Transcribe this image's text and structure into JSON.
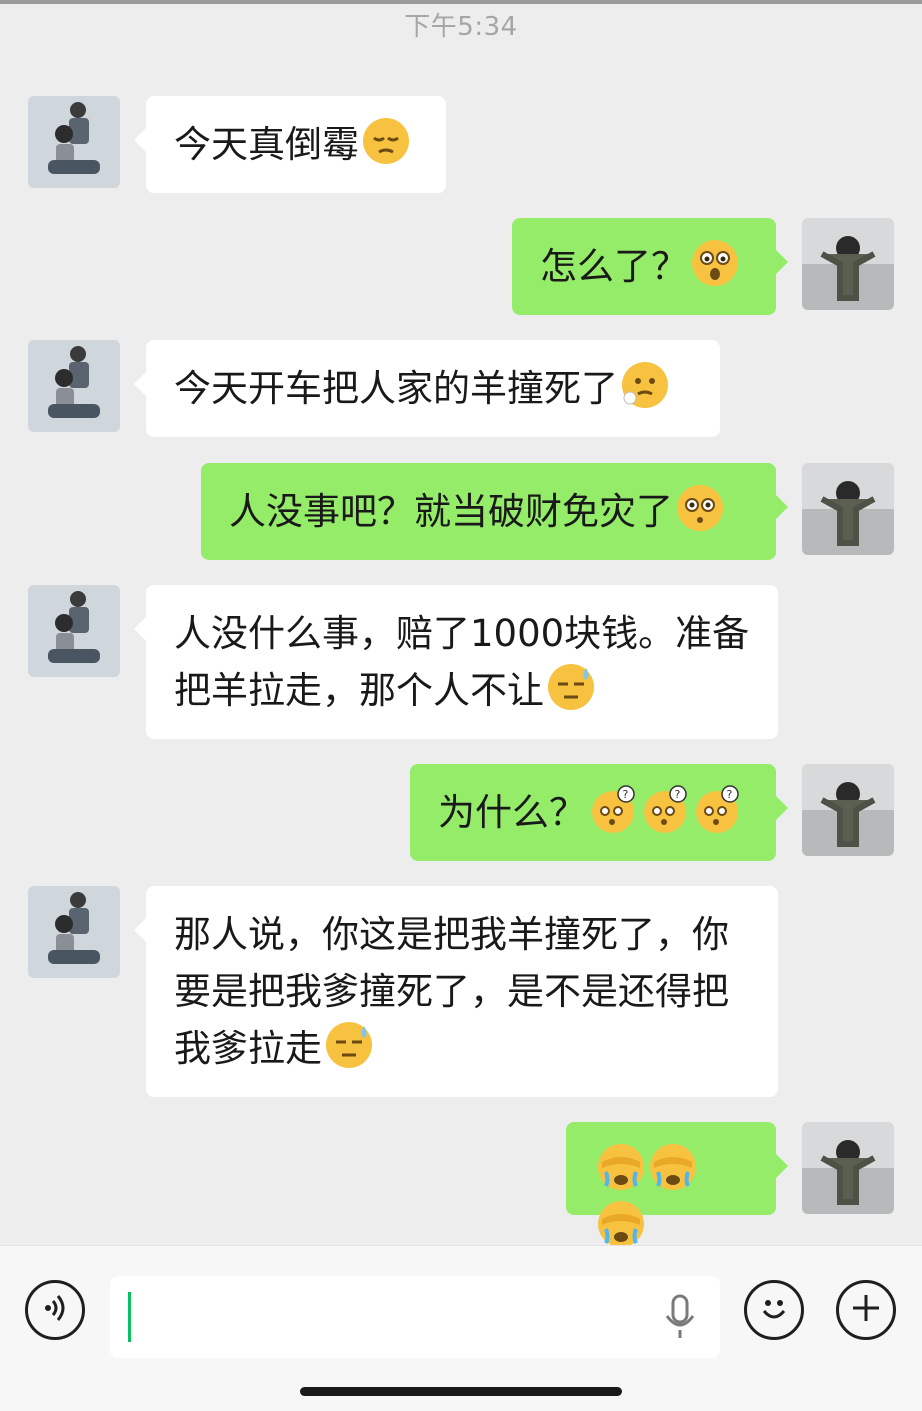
{
  "status": {
    "time": "下午5:34"
  },
  "messages": [
    {
      "side": "left",
      "text": "今天真倒霉",
      "emojis": [
        "pensive-emoji"
      ]
    },
    {
      "side": "right",
      "text": "怎么了？",
      "emojis": [
        "shocked-emoji"
      ]
    },
    {
      "side": "left",
      "text": "今天开车把人家的羊撞死了",
      "emojis": [
        "sigh-emoji"
      ]
    },
    {
      "side": "right",
      "text": "人没事吧？就当破财免灾了",
      "emojis": [
        "wide-eyed-emoji"
      ]
    },
    {
      "side": "left",
      "text": "人没什么事，赔了1000块钱。准备把羊拉走，那个人不让",
      "emojis": [
        "sweat-emoji"
      ]
    },
    {
      "side": "right",
      "text": "为什么？",
      "emojis": [
        "confused-emoji",
        "confused-emoji",
        "confused-emoji"
      ]
    },
    {
      "side": "left",
      "text": "那人说，你这是把我羊撞死了，你要是把我爹撞死了，是不是还得把我爹拉走",
      "emojis": [
        "sweat-emoji"
      ]
    },
    {
      "side": "right",
      "text": "",
      "emojis": [
        "facepalm-cry-emoji",
        "facepalm-cry-emoji",
        "facepalm-cry-emoji"
      ]
    }
  ],
  "input": {
    "value": ""
  },
  "colors": {
    "background": "#ededed",
    "self_bubble": "#95ec69",
    "other_bubble": "#ffffff",
    "cursor": "#07c160"
  }
}
